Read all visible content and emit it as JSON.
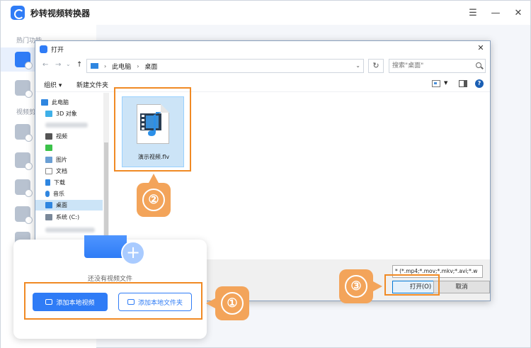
{
  "app": {
    "title": "秒转视频转换器",
    "sidebar_heading_1": "热门功能",
    "sidebar_heading_2": "视频剪",
    "window_controls": {
      "menu": "☰",
      "minimize": "—",
      "close": "✕"
    }
  },
  "dialog": {
    "title": "打开",
    "address": {
      "part1": "此电脑",
      "part2": "桌面"
    },
    "search": {
      "placeholder": "搜索\"桌面\""
    },
    "toolbar": {
      "organize": "组织 ▾",
      "new_folder": "新建文件夹"
    },
    "nav_items": [
      "此电脑",
      "3D 对象",
      "视频",
      "图片",
      "文档",
      "下载",
      "音乐",
      "桌面",
      "系统 (C:)"
    ],
    "file": {
      "name": "演示视频.flv"
    },
    "file_type": "* (*.mp4;*.mov;*.mkv;*.avi;*.w",
    "open_button": "打开(O)",
    "cancel_button": "取消"
  },
  "card": {
    "empty_text": "还没有视频文件",
    "add_local_video": "添加本地视频",
    "add_local_folder": "添加本地文件夹"
  },
  "annotations": {
    "step1": "①",
    "step2": "②",
    "step3": "③"
  },
  "colors": {
    "accent": "#2f7cf6",
    "annotation": "#f08a24",
    "badge": "#f3a45a",
    "selection": "#cce4f7"
  }
}
